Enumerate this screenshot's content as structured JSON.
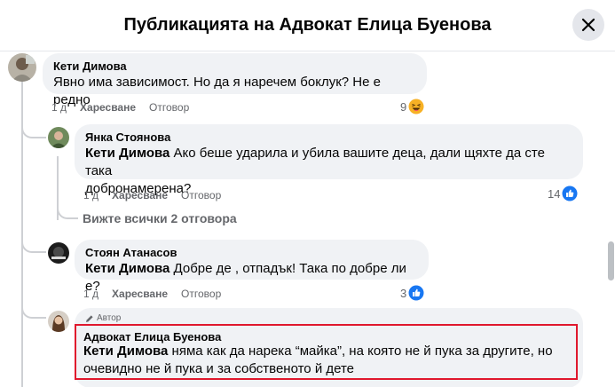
{
  "dialog": {
    "title": "Публикацията на Адвокат Елица Буенова"
  },
  "comments": {
    "c1": {
      "author": "Кети Димова",
      "text": "Явно има зависимост. Но да я наречем боклук? Не е редно",
      "time": "1 д",
      "like_label": "Харесване",
      "reply_label": "Отговор",
      "reaction_count": "9",
      "reaction_icon": "haha-icon"
    },
    "r1": {
      "author": "Янка Стоянова",
      "mention": "Кети Димова",
      "text_line1": " Ако беше ударила и убила вашите деца, дали щяхте да сте така",
      "text_line2": "добронамерена?",
      "time": "1 д",
      "like_label": "Харесване",
      "reply_label": "Отговор",
      "reaction_count": "14",
      "reaction_icon": "like-icon"
    },
    "view_replies": "Вижте всички 2 отговора",
    "r2": {
      "author": "Стоян Атанасов",
      "mention": "Кети Димова",
      "text": " Добре де , отпадък! Така по добре ли е?",
      "time": "1 д",
      "like_label": "Харесване",
      "reply_label": "Отговор",
      "reaction_count": "3",
      "reaction_icon": "like-icon"
    },
    "r3": {
      "badge": "Автор",
      "author": "Адвокат Елица Буенова",
      "mention": "Кети Димова",
      "text_line1": " няма как да нарека “майка”, на която не й пука за другите, но",
      "text_line2": "очевидно не й пука и за собственото й дете"
    }
  },
  "colors": {
    "bubble": "#f0f2f5",
    "secondary_text": "#65676b",
    "like_blue": "#1877f2",
    "highlight_red": "#e0182d"
  }
}
